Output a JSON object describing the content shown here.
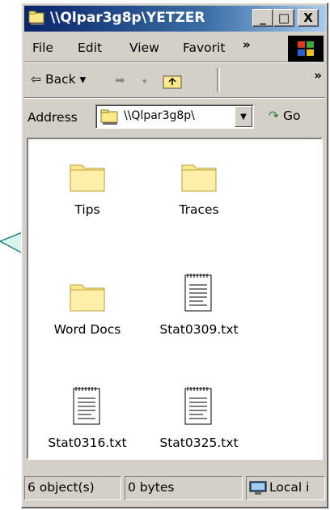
{
  "window": {
    "title": "\\\\Qlpar3g8p\\YETZER",
    "min_label": "_",
    "max_label": "□",
    "close_label": "X"
  },
  "menu": {
    "file": "File",
    "edit": "Edit",
    "view": "View",
    "favorites": "Favorit",
    "more": "»"
  },
  "toolbar": {
    "back_label": "Back",
    "more": "»"
  },
  "address": {
    "label": "Address",
    "value": "\\\\Qlpar3g8p\\",
    "go_label": "Go"
  },
  "items": [
    {
      "name": "Tips",
      "type": "folder"
    },
    {
      "name": "Traces",
      "type": "folder"
    },
    {
      "name": "Word Docs",
      "type": "folder"
    },
    {
      "name": "Stat0309.txt",
      "type": "text-file"
    },
    {
      "name": "Stat0316.txt",
      "type": "text-file"
    },
    {
      "name": "Stat0325.txt",
      "type": "text-file"
    }
  ],
  "status": {
    "objects": "6 object(s)",
    "size": "0 bytes",
    "zone": "Local i"
  },
  "colors": {
    "title_start": "#0a246a",
    "title_end": "#a6caf0",
    "folder": "#fde98a",
    "pointer": "#d8f4ec"
  }
}
